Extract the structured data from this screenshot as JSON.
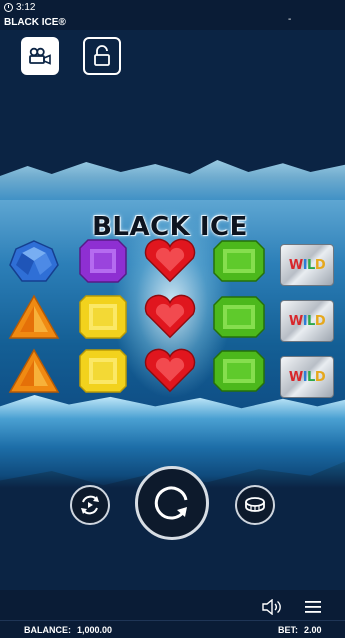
{
  "status_bar": {
    "time": "3:12",
    "title": "BLACK ICE®",
    "right_mark": "-"
  },
  "top_buttons": {
    "camera": "camera-icon",
    "lock": "lock-icon"
  },
  "logo_text": "BLACK ICE",
  "reels": [
    [
      "blue-gem",
      "orange-triangle-gem",
      "orange-triangle-gem"
    ],
    [
      "purple-gem",
      "yellow-square-gem",
      "yellow-square-gem"
    ],
    [
      "red-heart-gem",
      "red-heart-gem",
      "red-heart-gem"
    ],
    [
      "green-emerald-gem",
      "green-emerald-gem",
      "green-emerald-gem"
    ],
    [
      "wild",
      "wild",
      "wild"
    ]
  ],
  "wild_label": "WILD",
  "controls": {
    "autoplay": "autoplay-icon",
    "spin": "spin-icon",
    "coin": "coin-stack-icon"
  },
  "footer": {
    "sound": "speaker-icon",
    "menu": "menu-icon",
    "balance_label": "BALANCE:",
    "balance_value": "1,000.00",
    "bet_label": "BET:",
    "bet_value": "2.00"
  }
}
